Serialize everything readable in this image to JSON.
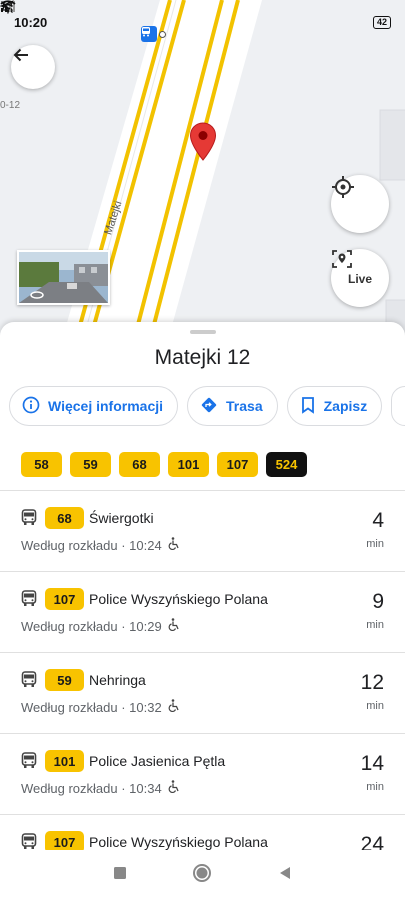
{
  "status_bar": {
    "time": "10:20",
    "battery": "42"
  },
  "map": {
    "street_label": "Matejki",
    "edge_label": "0-12"
  },
  "place": {
    "title": "Matejki 12"
  },
  "actions": [
    {
      "label": "Więcej informacji",
      "icon": "info-icon"
    },
    {
      "label": "Trasa",
      "icon": "directions-icon"
    },
    {
      "label": "Zapisz",
      "icon": "bookmark-icon"
    }
  ],
  "live_label": "Live",
  "routes": [
    "58",
    "59",
    "68",
    "101",
    "107",
    "524"
  ],
  "departures": [
    {
      "line": "68",
      "destination": "Świergotki",
      "schedule": "Według rozkładu · 10:24",
      "minutes": "4",
      "unit": "min"
    },
    {
      "line": "107",
      "destination": "Police Wyszyńskiego Polana",
      "schedule": "Według rozkładu · 10:29",
      "minutes": "9",
      "unit": "min"
    },
    {
      "line": "59",
      "destination": "Nehringa",
      "schedule": "Według rozkładu · 10:32",
      "minutes": "12",
      "unit": "min"
    },
    {
      "line": "101",
      "destination": "Police Jasienica Pętla",
      "schedule": "Według rozkładu · 10:34",
      "minutes": "14",
      "unit": "min"
    },
    {
      "line": "107",
      "destination": "Police Wyszyńskiego Polana",
      "schedule": "",
      "minutes": "24",
      "unit": ""
    }
  ],
  "colors": {
    "accent": "#1a73e8",
    "route_yellow": "#f8c300",
    "route_dark": "#111111",
    "pin_red": "#e53935"
  }
}
